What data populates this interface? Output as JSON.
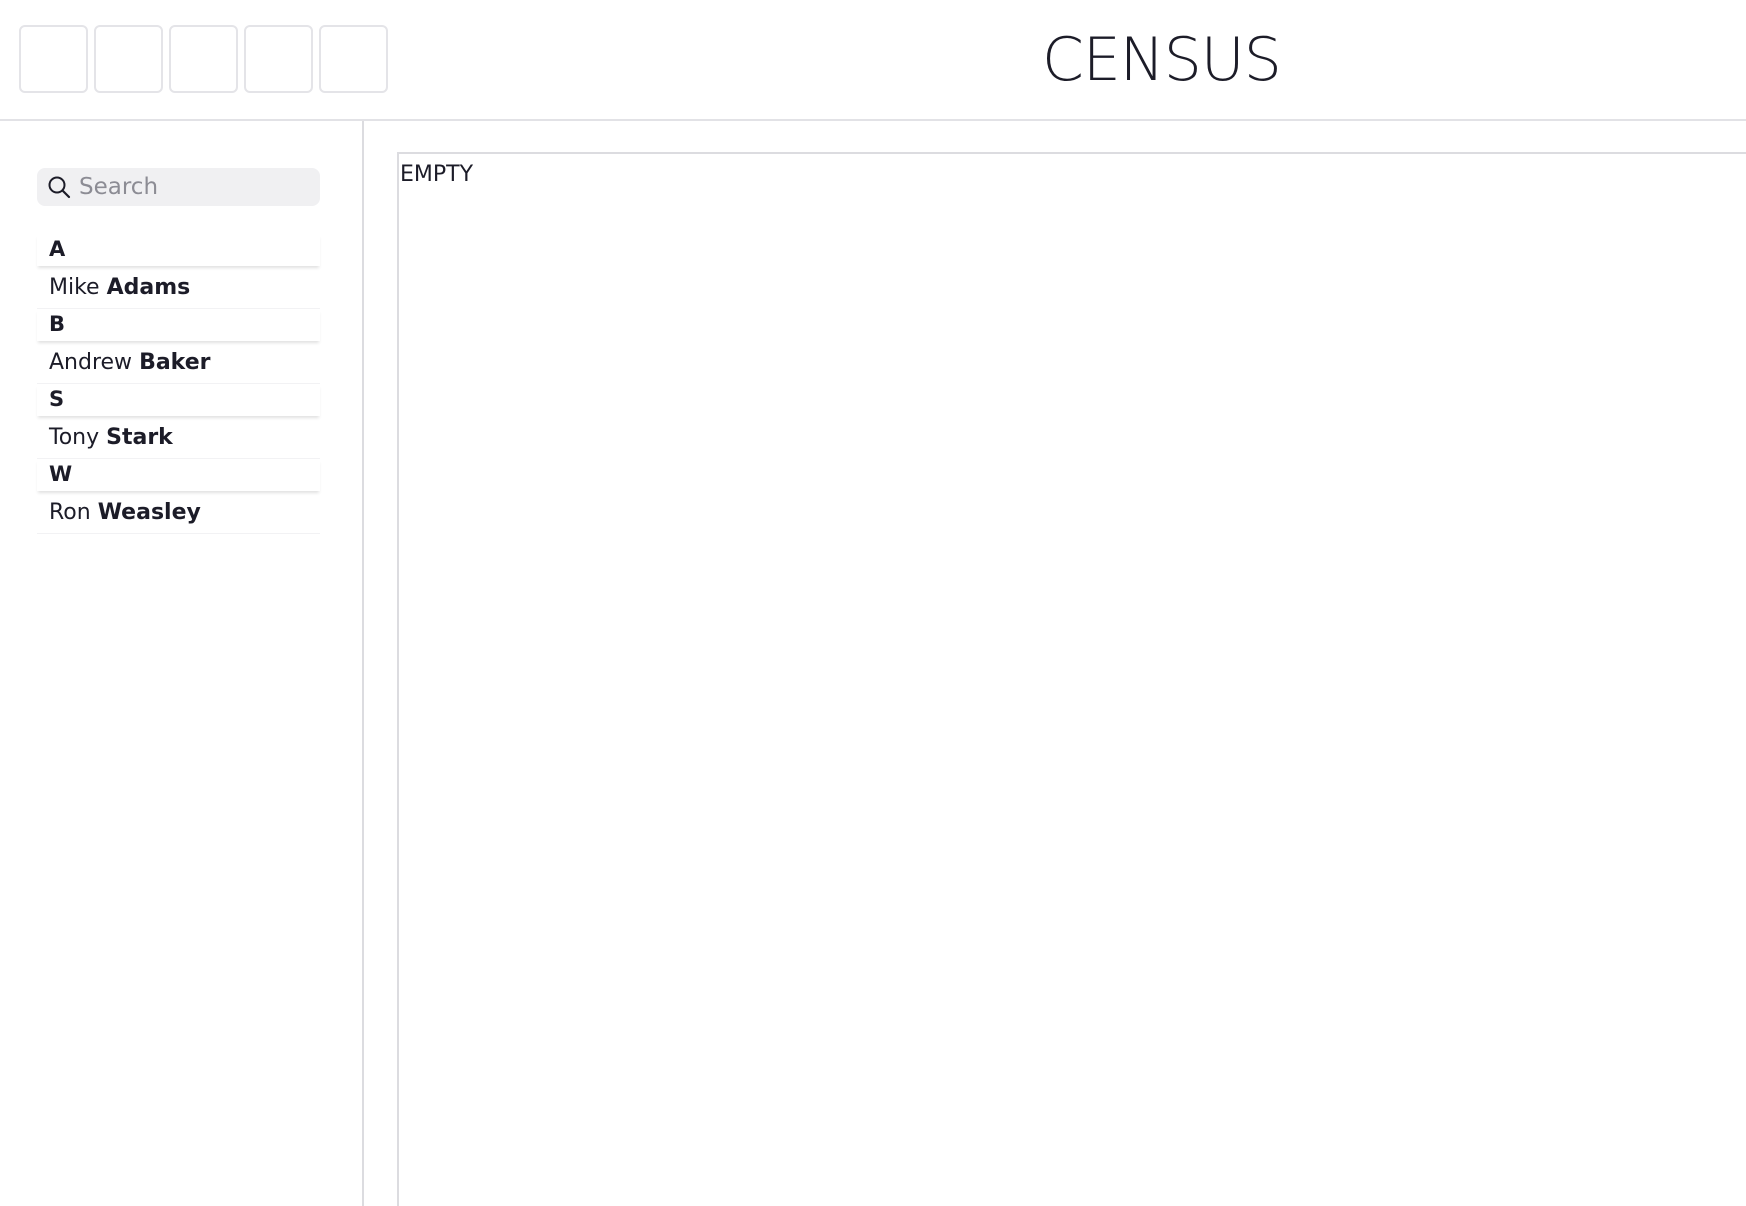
{
  "header": {
    "title": "CENSUS",
    "toolbar_buttons": [
      "",
      "",
      "",
      "",
      ""
    ]
  },
  "sidebar": {
    "search": {
      "placeholder": "Search",
      "value": ""
    },
    "sections": [
      {
        "letter": "A",
        "people": [
          {
            "first": "Mike",
            "last": "Adams"
          }
        ]
      },
      {
        "letter": "B",
        "people": [
          {
            "first": "Andrew",
            "last": "Baker"
          }
        ]
      },
      {
        "letter": "S",
        "people": [
          {
            "first": "Tony",
            "last": "Stark"
          }
        ]
      },
      {
        "letter": "W",
        "people": [
          {
            "first": "Ron",
            "last": "Weasley"
          }
        ]
      }
    ]
  },
  "main": {
    "empty_label": "EMPTY"
  }
}
